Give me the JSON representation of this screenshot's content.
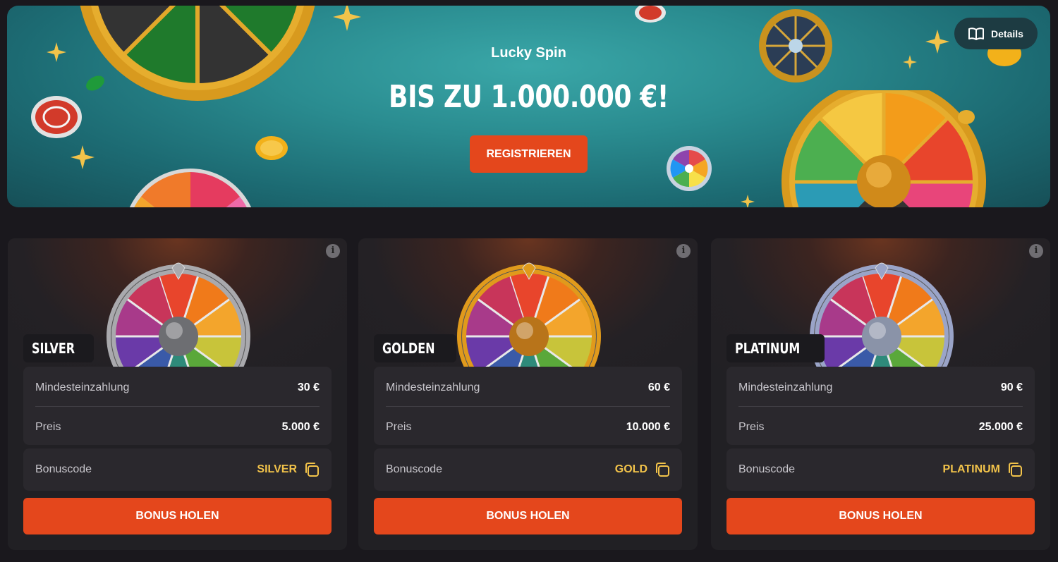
{
  "hero": {
    "title": "Lucky Spin",
    "amount": "BIS ZU 1.000.000 €!",
    "register_label": "REGISTRIEREN",
    "details_label": "Details"
  },
  "colors": {
    "accent": "#e4471c",
    "code_gold": "#f2c34a",
    "card_bg": "#212024",
    "banner_teal": "#2a8c90"
  },
  "cards": [
    {
      "tier": "SILVER",
      "min_deposit_label": "Mindesteinzahlung",
      "min_deposit_value": "30 €",
      "price_label": "Preis",
      "price_value": "5.000 €",
      "code_label": "Bonuscode",
      "code_value": "SILVER",
      "button_label": "BONUS HOLEN",
      "rim_color": "#a9a9ad",
      "hub_color": "#6d6e72"
    },
    {
      "tier": "GOLDEN",
      "min_deposit_label": "Mindesteinzahlung",
      "min_deposit_value": "60 €",
      "price_label": "Preis",
      "price_value": "10.000 €",
      "code_label": "Bonuscode",
      "code_value": "GOLD",
      "button_label": "BONUS HOLEN",
      "rim_color": "#e09a1c",
      "hub_color": "#b8741a"
    },
    {
      "tier": "PLATINUM",
      "min_deposit_label": "Mindesteinzahlung",
      "min_deposit_value": "90 €",
      "price_label": "Preis",
      "price_value": "25.000 €",
      "code_label": "Bonuscode",
      "code_value": "PLATINUM",
      "button_label": "BONUS HOLEN",
      "rim_color": "#9aa4c8",
      "hub_color": "#8a93a8"
    }
  ]
}
